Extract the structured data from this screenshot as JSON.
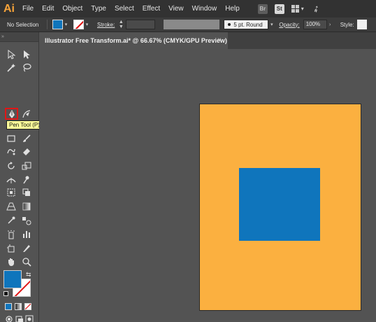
{
  "app": {
    "logo": "Ai"
  },
  "menu": [
    "File",
    "Edit",
    "Object",
    "Type",
    "Select",
    "Effect",
    "View",
    "Window",
    "Help"
  ],
  "menu_icons": {
    "bridge": "Br",
    "stock": "St"
  },
  "control_bar": {
    "selection_label": "No Selection",
    "stroke_label": "Stroke:",
    "brush_label": "5 pt. Round",
    "opacity_label": "Opacity:",
    "opacity_value": "100%",
    "style_label": "Style:"
  },
  "document": {
    "tab_title": "Illustrator Free Transform.ai* @ 66.67% (CMYK/GPU Preview)",
    "close_glyph": "×"
  },
  "tooltip": "Pen Tool (P)",
  "colors": {
    "fill": "#0f75bc",
    "artboard_fill": "#fbb040",
    "square_fill": "#0f75bc",
    "stroke_none": "#e01616"
  },
  "icons": {
    "swap": "⇆"
  }
}
